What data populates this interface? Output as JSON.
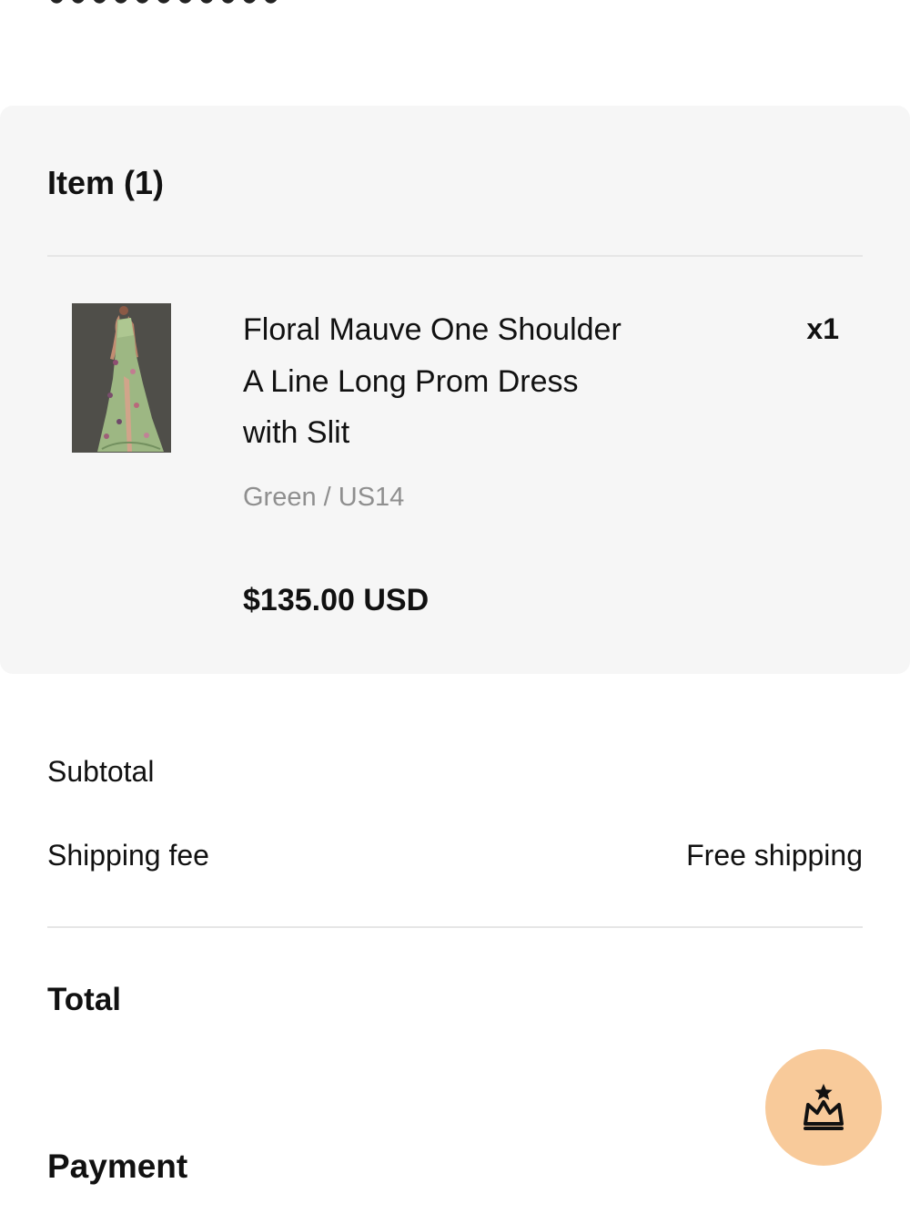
{
  "order_items": {
    "heading": "Item (1)",
    "products": [
      {
        "name": "Floral Mauve One Shoulder A Line Long Prom Dress with Slit",
        "variant": "Green / US14",
        "price": "$135.00 USD",
        "quantity": "x1"
      }
    ]
  },
  "summary": {
    "subtotal_label": "Subtotal",
    "shipping_label": "Shipping fee",
    "shipping_value": "Free shipping",
    "total_label": "Total"
  },
  "payment": {
    "heading": "Payment"
  },
  "floating_action": {
    "icon": "crown-icon",
    "background": "#f8ca9a"
  },
  "colors": {
    "card_background": "#f6f6f6",
    "muted_text": "#8f8f8f",
    "primary_text": "#111111"
  }
}
